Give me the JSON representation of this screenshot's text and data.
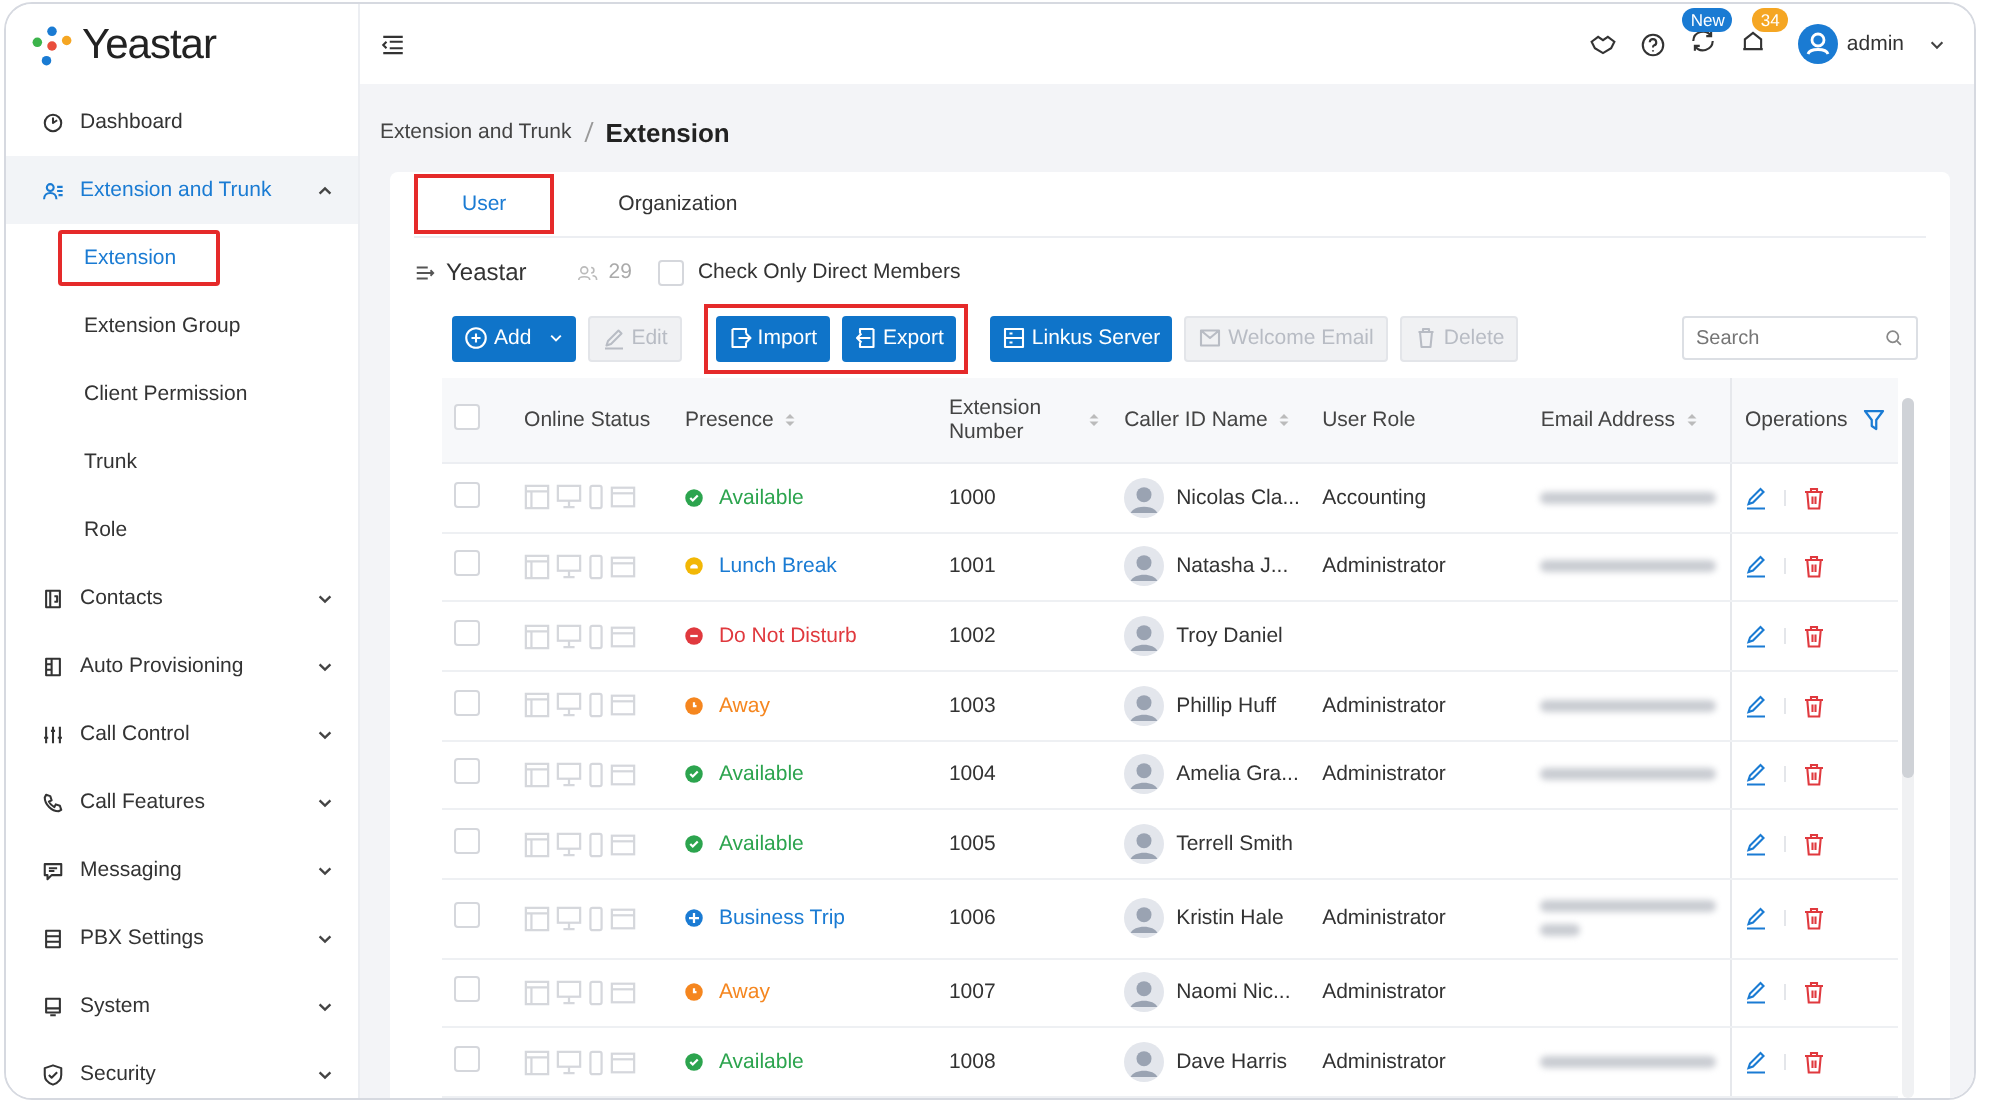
{
  "logo": {
    "text": "Yeastar"
  },
  "sidebar": {
    "items": [
      {
        "label": "Dashboard",
        "has_children": false,
        "selected": false
      },
      {
        "label": "Extension and Trunk",
        "expanded": true,
        "has_children": true,
        "selected": true,
        "children": [
          {
            "label": "Extension",
            "selected": true,
            "highlighted": true
          },
          {
            "label": "Extension Group",
            "selected": false,
            "highlighted": false
          },
          {
            "label": "Client Permission",
            "selected": false,
            "highlighted": false
          },
          {
            "label": "Trunk",
            "selected": false,
            "highlighted": false
          },
          {
            "label": "Role",
            "selected": false,
            "highlighted": false
          }
        ]
      },
      {
        "label": "Contacts",
        "expanded": false,
        "has_children": true,
        "selected": false
      },
      {
        "label": "Auto Provisioning",
        "expanded": false,
        "has_children": true,
        "selected": false
      },
      {
        "label": "Call Control",
        "expanded": false,
        "has_children": true,
        "selected": false
      },
      {
        "label": "Call Features",
        "expanded": false,
        "has_children": true,
        "selected": false
      },
      {
        "label": "Messaging",
        "expanded": false,
        "has_children": true,
        "selected": false
      },
      {
        "label": "PBX Settings",
        "expanded": false,
        "has_children": true,
        "selected": false
      },
      {
        "label": "System",
        "expanded": false,
        "has_children": true,
        "selected": false
      },
      {
        "label": "Security",
        "expanded": false,
        "has_children": true,
        "selected": false
      }
    ]
  },
  "header": {
    "new_badge": "New",
    "notification_count": "34",
    "user": "admin"
  },
  "breadcrumb": [
    "Extension and Trunk",
    "Extension"
  ],
  "tabs": [
    {
      "label": "User",
      "selected": true,
      "highlighted": true
    },
    {
      "label": "Organization",
      "selected": false,
      "highlighted": false
    }
  ],
  "org": {
    "name": "Yeastar",
    "member_count": "29",
    "direct_members": {
      "label": "Check Only Direct Members",
      "checked": false
    }
  },
  "toolbar": {
    "groups": [
      {
        "highlighted": false,
        "buttons": [
          {
            "label": "Add",
            "kind": "add",
            "disabled": false,
            "dropdown": true
          },
          {
            "label": "Edit",
            "kind": "edit",
            "disabled": true,
            "dropdown": false
          }
        ]
      },
      {
        "highlighted": true,
        "buttons": [
          {
            "label": "Import",
            "kind": "import",
            "disabled": false,
            "dropdown": false
          },
          {
            "label": "Export",
            "kind": "export",
            "disabled": false,
            "dropdown": false
          }
        ]
      },
      {
        "highlighted": false,
        "buttons": [
          {
            "label": "Linkus Server",
            "kind": "server",
            "disabled": false,
            "dropdown": false
          },
          {
            "label": "Welcome Email",
            "kind": "mail",
            "disabled": true,
            "dropdown": false
          },
          {
            "label": "Delete",
            "kind": "trash",
            "disabled": true,
            "dropdown": false
          }
        ]
      }
    ],
    "search": {
      "placeholder": "Search"
    }
  },
  "table": {
    "all_checked": false,
    "columns": [
      {
        "label": "Online Status",
        "sortable": false
      },
      {
        "label": "Presence",
        "sortable": true
      },
      {
        "label": "Extension Number",
        "sortable": true
      },
      {
        "label": "Caller ID Name",
        "sortable": true
      },
      {
        "label": "User Role",
        "sortable": false
      },
      {
        "label": "Email Address",
        "sortable": true
      },
      {
        "label": "Operations",
        "sortable": false
      }
    ],
    "rows": [
      {
        "checked": false,
        "presence": {
          "label": "Available",
          "kind": "available"
        },
        "number": "1000",
        "name": "Nicolas Cla...",
        "role": "Accounting",
        "blurred_email": true,
        "email_wraps": false
      },
      {
        "checked": false,
        "presence": {
          "label": "Lunch Break",
          "kind": "lunch"
        },
        "number": "1001",
        "name": "Natasha J...",
        "role": "Administrator",
        "blurred_email": true,
        "email_wraps": false
      },
      {
        "checked": false,
        "presence": {
          "label": "Do Not Disturb",
          "kind": "dnd"
        },
        "number": "1002",
        "name": "Troy Daniel",
        "blurred_email": false
      },
      {
        "checked": false,
        "presence": {
          "label": "Away",
          "kind": "away"
        },
        "number": "1003",
        "name": "Phillip Huff",
        "role": "Administrator",
        "blurred_email": true,
        "email_wraps": false
      },
      {
        "checked": false,
        "presence": {
          "label": "Available",
          "kind": "available"
        },
        "number": "1004",
        "name": "Amelia Gra...",
        "role": "Administrator",
        "blurred_email": true,
        "email_wraps": false
      },
      {
        "checked": false,
        "presence": {
          "label": "Available",
          "kind": "available"
        },
        "number": "1005",
        "name": "Terrell Smith",
        "blurred_email": false
      },
      {
        "checked": false,
        "presence": {
          "label": "Business Trip",
          "kind": "trip"
        },
        "number": "1006",
        "name": "Kristin Hale",
        "role": "Administrator",
        "blurred_email": true,
        "email_wraps": true
      },
      {
        "checked": false,
        "presence": {
          "label": "Away",
          "kind": "away"
        },
        "number": "1007",
        "name": "Naomi Nic...",
        "role": "Administrator",
        "blurred_email": false
      },
      {
        "checked": false,
        "presence": {
          "label": "Available",
          "kind": "available"
        },
        "number": "1008",
        "name": "Dave Harris",
        "role": "Administrator",
        "blurred_email": true,
        "email_wraps": false
      }
    ]
  }
}
